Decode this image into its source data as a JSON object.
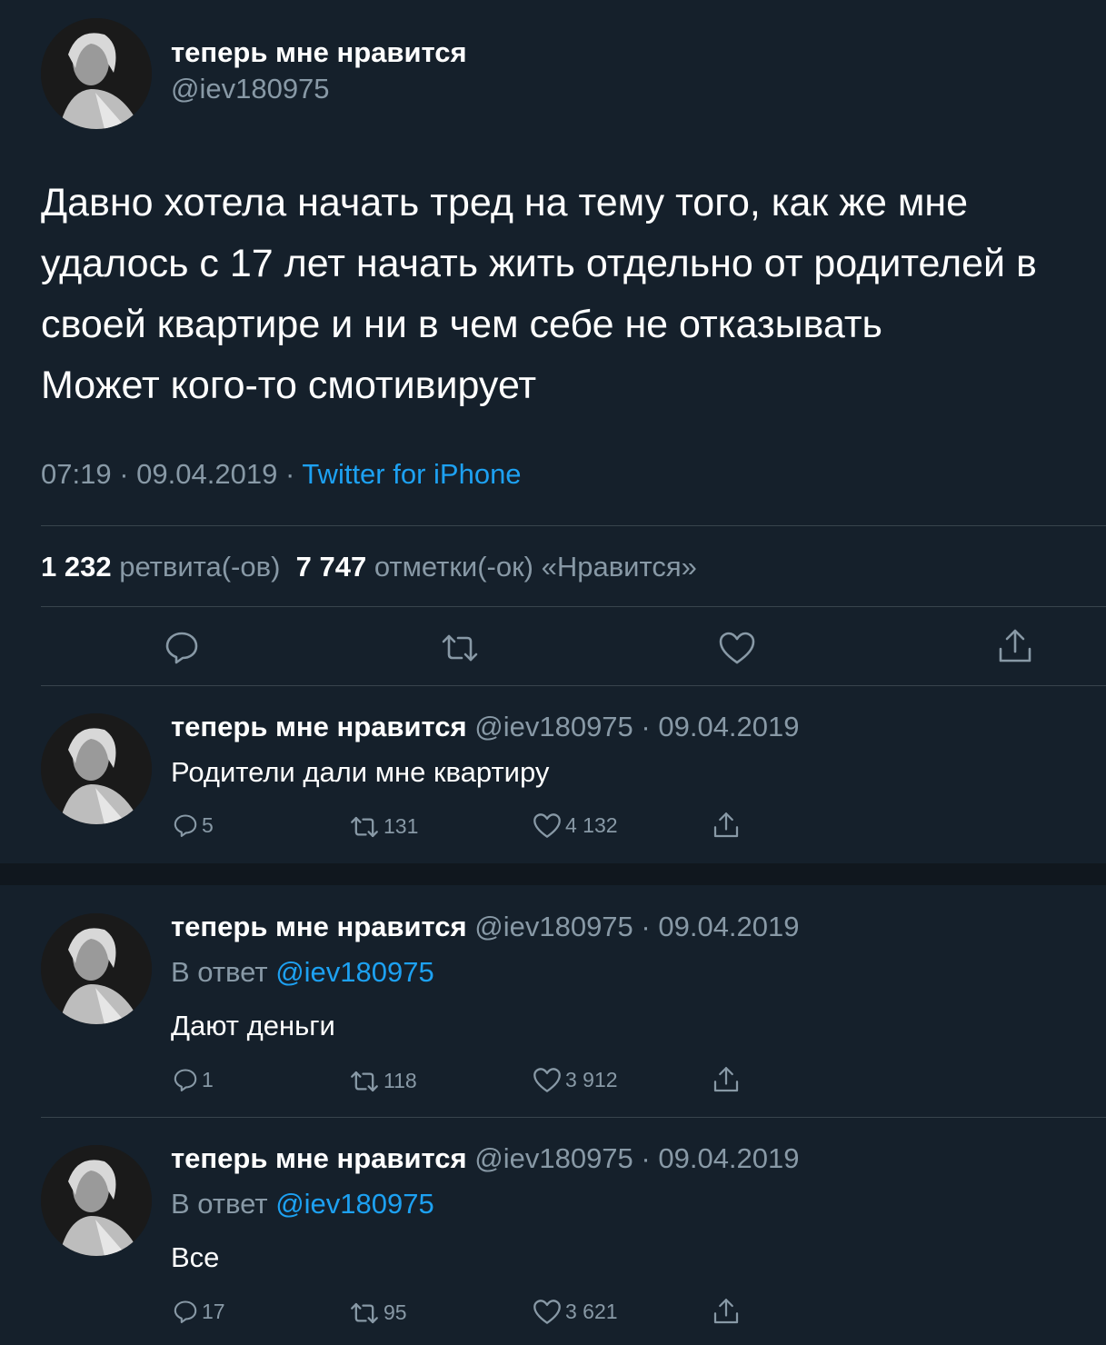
{
  "main_tweet": {
    "name": "теперь мне нравится",
    "handle": "@iev180975",
    "text_lines": [
      "Давно хотела начать тред на тему того, как же мне",
      "удалось с 17 лет начать жить отдельно от родителей в",
      "своей квартире и ни в чем себе не отказывать",
      "Может кого-то смотивирует"
    ],
    "time": "07:19",
    "date": "09.04.2019",
    "separator": "·",
    "source": "Twitter for iPhone",
    "retweets_count": "1 232",
    "retweets_label": "ретвита(-ов)",
    "likes_count": "7 747",
    "likes_label": "отметки(-ок) «Нравится»"
  },
  "replies": [
    {
      "name": "теперь мне нравится",
      "handle": "@iev180975",
      "date": "· 09.04.2019",
      "reply_prefix": "",
      "reply_to": "",
      "text": "Родители дали мне квартиру",
      "replies": "5",
      "retweets": "131",
      "likes": "4 132"
    },
    {
      "name": "теперь мне нравится",
      "handle": "@iev180975",
      "date": "· 09.04.2019",
      "reply_prefix": "В ответ",
      "reply_to": "@iev180975",
      "text": "Дают деньги",
      "replies": "1",
      "retweets": "118",
      "likes": "3 912"
    },
    {
      "name": "теперь мне нравится",
      "handle": "@iev180975",
      "date": "· 09.04.2019",
      "reply_prefix": "В ответ",
      "reply_to": "@iev180975",
      "text": "Все",
      "replies": "17",
      "retweets": "95",
      "likes": "3 621"
    }
  ],
  "colors": {
    "background": "#15202b",
    "secondary_text": "#8899a6",
    "accent": "#1da1f2",
    "divider": "#38444d"
  }
}
